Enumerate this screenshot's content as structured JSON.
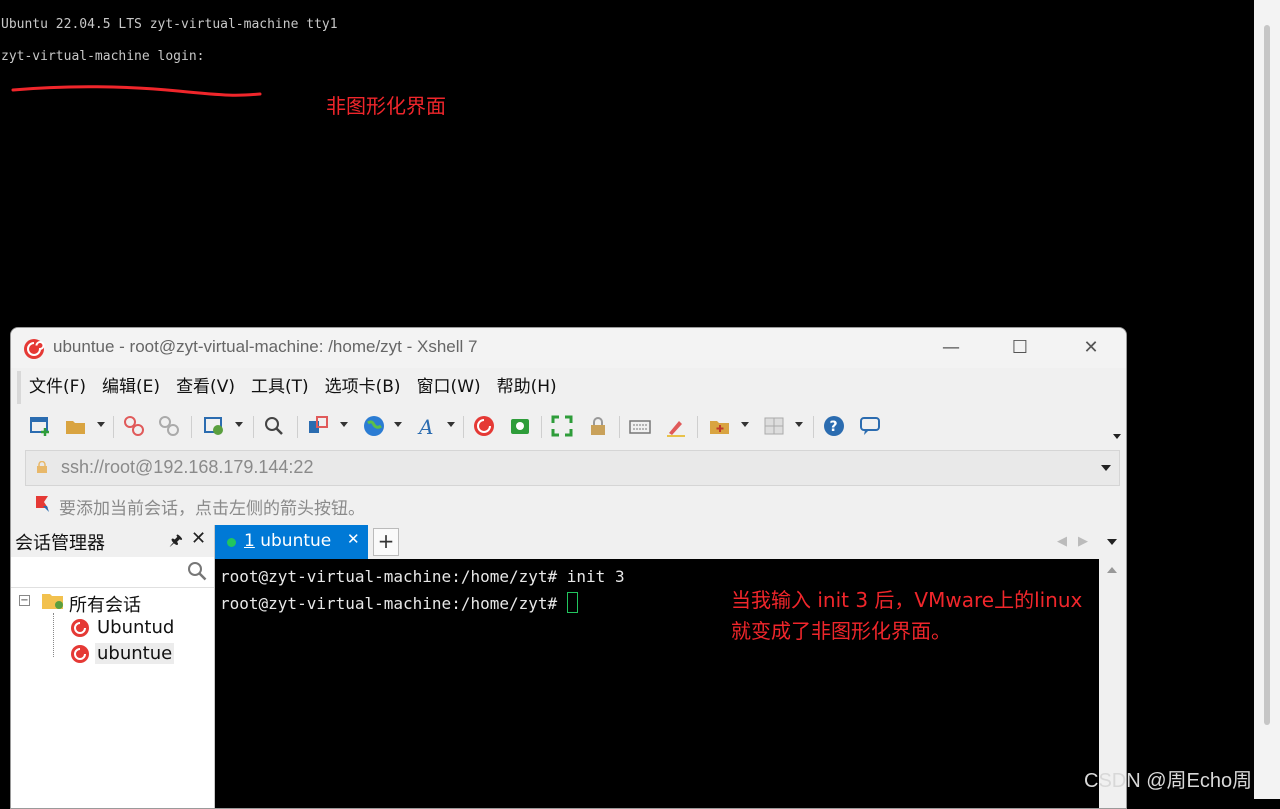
{
  "vm_console": {
    "line1": "Ubuntu 22.04.5 LTS zyt-virtual-machine tty1",
    "line2": "zyt-virtual-machine login:",
    "annotation": "非图形化界面"
  },
  "xshell": {
    "title": "ubuntue - root@zyt-virtual-machine: /home/zyt - Xshell 7",
    "window_controls": {
      "minimize": "—",
      "maximize": "☐",
      "close": "✕"
    },
    "menu": [
      "文件(F)",
      "编辑(E)",
      "查看(V)",
      "工具(T)",
      "选项卡(B)",
      "窗口(W)",
      "帮助(H)"
    ],
    "address": "ssh://root@192.168.179.144:22",
    "hint": "要添加当前会话，点击左侧的箭头按钮。",
    "session_manager": {
      "title": "会话管理器",
      "pin": "⊿",
      "close": "✕",
      "root_folder": "所有会话",
      "expander": "−",
      "sessions": [
        "Ubuntud",
        "ubuntue"
      ]
    },
    "tab": {
      "number": "1",
      "label": "ubuntue",
      "close": "✕",
      "add": "+",
      "prev": "◀",
      "next": "▶"
    },
    "terminal": {
      "prompt": "root@zyt-virtual-machine:/home/zyt#",
      "lines": [
        "root@zyt-virtual-machine:/home/zyt# init 3",
        "root@zyt-virtual-machine:/home/zyt# "
      ]
    },
    "annotation_line1": "当我输入 init 3 后，VMware上的linux",
    "annotation_line2": "就变成了非图形化界面。"
  },
  "watermark": "CSDN @周Echo周",
  "colors": {
    "accent": "#0079d6",
    "annotation": "#f0262b",
    "cursor": "#22c55e"
  }
}
